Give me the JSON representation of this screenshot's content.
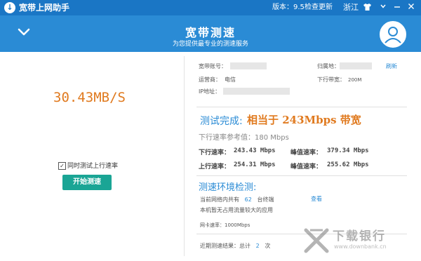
{
  "titlebar": {
    "app_title": "宽带上网助手",
    "version_label": "版本：9.5",
    "check_update": "检查更新",
    "region": "浙江"
  },
  "header": {
    "title": "宽带测速",
    "subtitle": "为您提供最专业的测速服务"
  },
  "left": {
    "speed": "30.43MB/S",
    "upload_checkbox_label": "同时测试上行速率",
    "upload_checked": true,
    "start_button": "开始测速"
  },
  "info": {
    "account_label": "宽带账号：",
    "location_label": "归属地：",
    "refresh": "刷新",
    "isp_label": "运营商：",
    "isp_value": "电信",
    "downlink_bw_label": "下行带宽：",
    "downlink_bw_value": "200M",
    "ip_label": "IP地址："
  },
  "result": {
    "done_label": "测试完成:",
    "done_value": "相当于 243Mbps 带宽",
    "reference": "下行速率参考值：180 Mbps",
    "down_label": "下行速率：",
    "down_value": "243.43 Mbps",
    "down_peak_label": "峰值速率：",
    "down_peak_value": "379.34 Mbps",
    "up_label": "上行速率：",
    "up_value": "254.31 Mbps",
    "up_peak_label": "峰值速率：",
    "up_peak_value": "255.62 Mbps"
  },
  "env": {
    "title": "测速环境检测:",
    "network_prefix": "当前网络内共有",
    "terminal_count": "62",
    "network_suffix": "台终端",
    "view": "查看",
    "no_heavy_apps": "本机暂无占用流量较大的应用",
    "nic_rate": "网卡速率：1000Mbps"
  },
  "history": {
    "prefix": "近期测速结果：总计",
    "count": "2",
    "suffix": "次"
  },
  "watermark": {
    "text": "下载银行",
    "url": "www.downbank.cn"
  },
  "colors": {
    "titlebar": "#1a76c5",
    "header": "#2a8bd5",
    "accent_orange": "#e07a1f",
    "button_teal": "#1aa595"
  }
}
